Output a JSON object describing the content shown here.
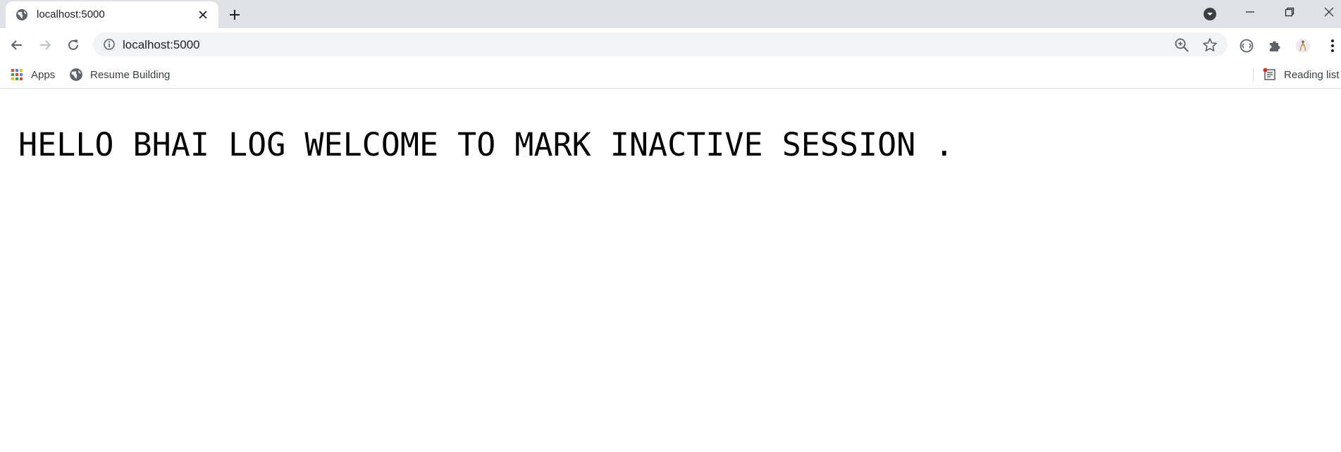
{
  "browser": {
    "tab": {
      "title": "localhost:5000",
      "favicon": "globe-icon"
    },
    "toolbar": {
      "url": "localhost:5000"
    },
    "bookmarks": {
      "apps_label": "Apps",
      "items": [
        {
          "label": "Resume Building",
          "icon": "globe-icon"
        }
      ],
      "reading_list_label": "Reading list"
    }
  },
  "page": {
    "heading": "HELLO BHAI LOG WELCOME TO MARK INACTIVE SESSION ."
  },
  "colors": {
    "tabstrip_bg": "#dee1e6",
    "omnibox_bg": "#f1f3f4",
    "icon_gray": "#5f6368",
    "text_dark": "#202124",
    "notification_dot": "#d93025"
  }
}
